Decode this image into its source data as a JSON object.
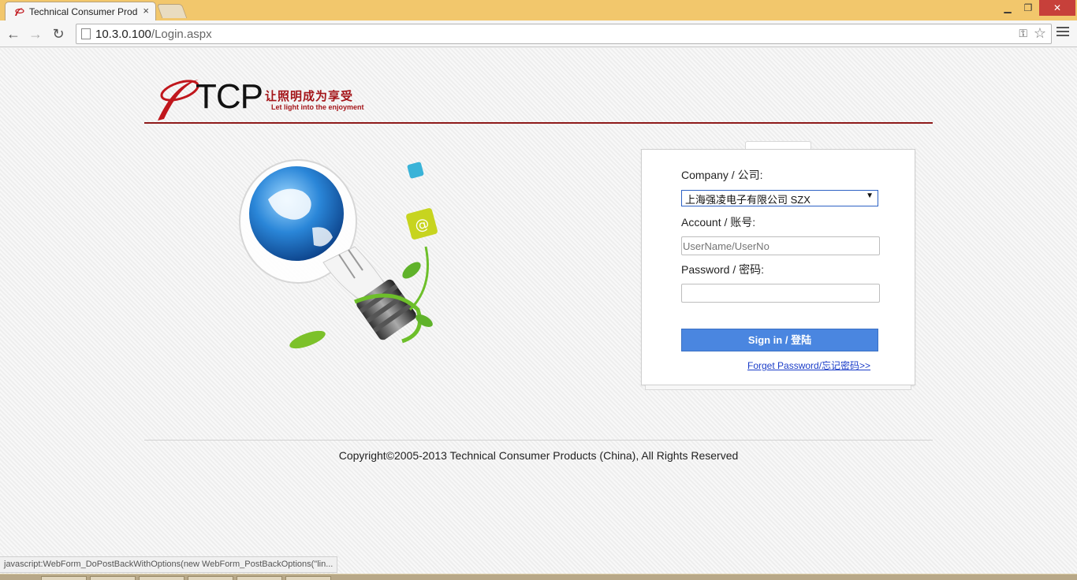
{
  "browser": {
    "tab_title": "Technical Consumer Prod",
    "tab_close": "×",
    "url_host": "10.3.0.100",
    "url_path": "/Login.aspx"
  },
  "logo": {
    "wordmark": "TCP",
    "slogan_cn": "让照明成为享受",
    "slogan_en": "Let light into the enjoyment"
  },
  "login": {
    "company_label": "Company / 公司:",
    "company_value": "上海强凌电子有限公司 SZX",
    "account_label": "Account / 账号:",
    "account_placeholder": "UserName/UserNo",
    "password_label": "Password / 密码:",
    "signin_label": "Sign in / 登陆",
    "forgot_label": "Forget Password/忘记密码>>"
  },
  "footer": {
    "copyright": "Copyright©2005-2013 Technical Consumer Products (China), All Rights Reserved"
  },
  "status": {
    "text": "javascript:WebForm_DoPostBackWithOptions(new WebForm_PostBackOptions(\"lin..."
  },
  "colors": {
    "brand_red": "#a4161a",
    "button_blue": "#4a86e0",
    "titlebar": "#f2c76c"
  }
}
